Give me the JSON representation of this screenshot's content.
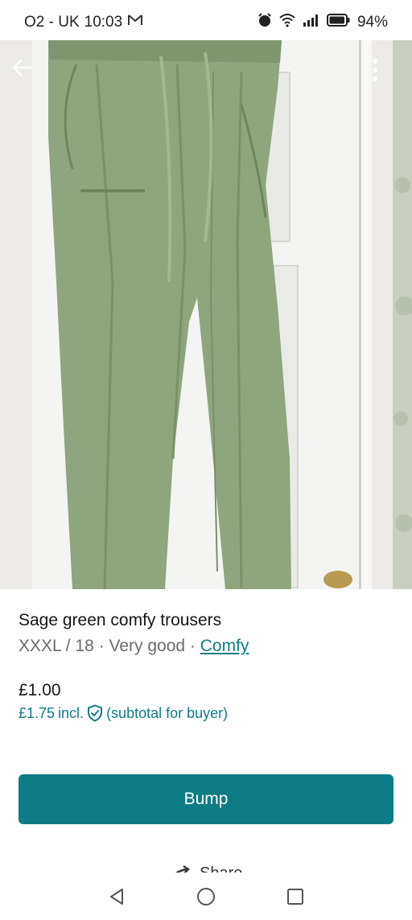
{
  "status_bar": {
    "carrier": "O2 - UK",
    "time": "10:03",
    "battery": "94%",
    "icons": [
      "gmail-icon",
      "alarm-icon",
      "wifi-icon",
      "signal-icon",
      "battery-icon"
    ]
  },
  "listing": {
    "title": "Sage green comfy trousers",
    "size": "XXXL / 18",
    "separator": "·",
    "condition": "Very good",
    "brand": "Comfy",
    "price": "£1.00",
    "buyer_price": "£1.75",
    "incl_label": "incl.",
    "subtotal_note": "(subtotal for buyer)"
  },
  "actions": {
    "bump_label": "Bump",
    "share_label": "Share"
  },
  "colors": {
    "accent": "#0e7c86",
    "trouser_green": "#8fa57e",
    "door_white": "#f4f4f2"
  }
}
